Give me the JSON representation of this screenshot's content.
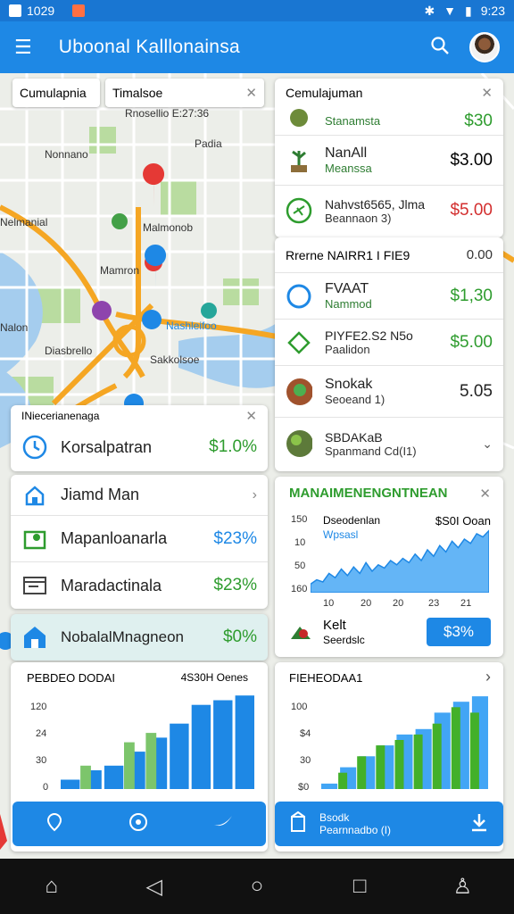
{
  "status": {
    "time_left": "1029",
    "time_right": "9:23"
  },
  "appbar": {
    "title": "Uboonal Kalllonainsa"
  },
  "search": {
    "chip1": "Cumulapnia",
    "chip2": "Timalsoe",
    "chip2_sub": "Rnosellio E:27:36"
  },
  "map_labels": [
    "Padia",
    "Nonnano",
    "Nelmanial",
    "Malmonob",
    "Mamron",
    "Nashleifoo",
    "Nalon",
    "Diasbrello",
    "Sakkolsoe"
  ],
  "left_panel": {
    "header": "INiecerianenaga",
    "items": [
      {
        "name": "Korsalpatran",
        "value": "$1.0%"
      },
      {
        "name": "Jiamd Man",
        "value": ""
      },
      {
        "name": "Mapanloanarla",
        "value": "$23%"
      },
      {
        "name": "Maradactinala",
        "value": "$23%"
      }
    ],
    "highlight": {
      "name": "NobalalMnagneon",
      "value": "$0%"
    }
  },
  "right_list": {
    "header": "Cemulajuman",
    "items": [
      {
        "name": "",
        "sub": "Stanamsta",
        "price": "$30"
      },
      {
        "name": "NanAll",
        "sub": "Meanssa",
        "price": "$3.00"
      },
      {
        "name": "Nahvst6565, Jlma",
        "sub": "Beannaon 3)",
        "price": "$5.00"
      }
    ],
    "group_header": "Rrerne NAIRR1 I FIE9",
    "group_value": "0.00",
    "group_items": [
      {
        "name": "FVAAT",
        "sub": "Nammod",
        "price": "$1,30"
      },
      {
        "name": "PIYFE2.S2 N5o",
        "sub": "Paalidon",
        "price": "$5.00"
      },
      {
        "name": "Snokak",
        "sub": "Seoeand 1)",
        "price": "5.05"
      },
      {
        "name": "SBDAKaB",
        "sub": "Spanmand Cd(I1)",
        "price": ""
      }
    ]
  },
  "mini_chart": {
    "title": "MANAIMENENGNTNEAN",
    "legend_left": "Dseodenlan",
    "legend_sub": "Wpsasl",
    "legend_right": "$S0I Ooan",
    "yticks": [
      "150",
      "10",
      "50",
      "160"
    ],
    "xticks": [
      "10",
      "20",
      "20",
      "23",
      "21"
    ],
    "footer_name": "Kelt",
    "footer_sub": "Seerdslc",
    "footer_btn": "$3%"
  },
  "left_chart": {
    "title": "PEBDEO DODAI",
    "right_label": "4S30H Oenes",
    "yticks": [
      "120",
      "24",
      "30",
      "0"
    ]
  },
  "right_chart": {
    "title": "FIEHEODAA1",
    "yticks": [
      "100",
      "$4",
      "30",
      "$0"
    ]
  },
  "bottom_right_btn": {
    "line1": "Bsodk",
    "line2": "Pearnnadbo (I)"
  },
  "chart_data": [
    {
      "type": "area",
      "title": "MANAIMENENGNTNEAN",
      "values": [
        8,
        12,
        10,
        18,
        14,
        22,
        16,
        24,
        18,
        28,
        20,
        26,
        23,
        30,
        26,
        32,
        28,
        36,
        30,
        40,
        34,
        44,
        38,
        48,
        42,
        50,
        46,
        55,
        52,
        58
      ]
    },
    {
      "type": "bar",
      "title": "PEBDEO DODAI",
      "series": [
        {
          "name": "",
          "values": [
            2,
            4,
            5,
            8,
            11,
            14,
            18,
            19,
            20
          ]
        },
        {
          "name": "",
          "values": [
            0,
            5,
            0,
            10,
            12,
            0,
            0,
            0,
            0
          ]
        }
      ]
    },
    {
      "type": "bar",
      "title": "FIEHEODAA1",
      "series": [
        {
          "name": "",
          "values": [
            1,
            4,
            6,
            8,
            10,
            11,
            14,
            16,
            17
          ]
        },
        {
          "name": "",
          "values": [
            0,
            3,
            6,
            8,
            9,
            10,
            12,
            15,
            14
          ]
        }
      ]
    }
  ],
  "colors": {
    "primary": "#1e88e5",
    "green": "#2e9c2e",
    "red": "#d32f2f"
  }
}
